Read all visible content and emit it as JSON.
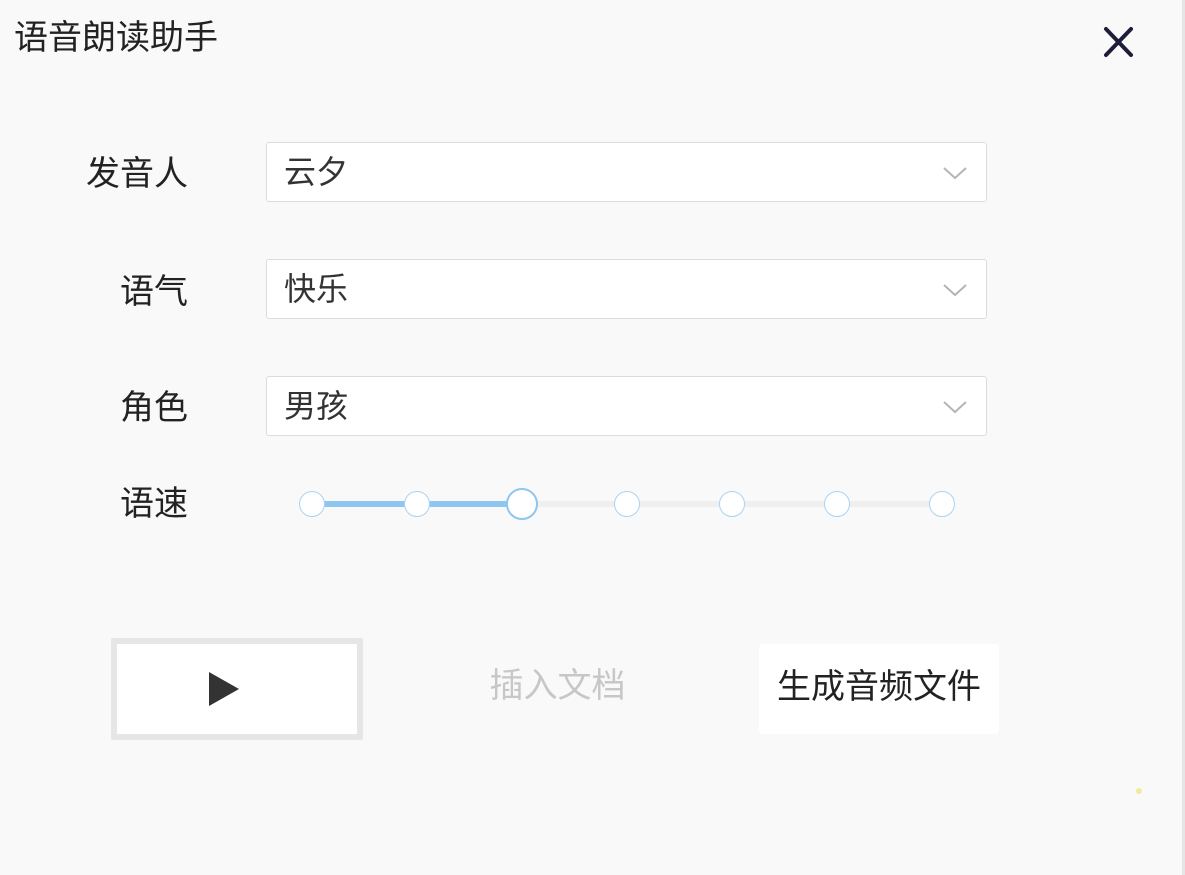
{
  "window": {
    "title": "语音朗读助手"
  },
  "icons": {
    "close": "close-icon",
    "chevron": "chevron-down-icon",
    "play": "play-icon"
  },
  "form": {
    "speaker": {
      "label": "发音人",
      "value": "云夕"
    },
    "tone": {
      "label": "语气",
      "value": "快乐"
    },
    "role": {
      "label": "角色",
      "value": "男孩"
    },
    "speed": {
      "label": "语速",
      "steps": 7,
      "selected_index": 2
    }
  },
  "actions": {
    "insert_label": "插入文档",
    "generate_label": "生成音频文件"
  },
  "colors": {
    "background": "#f9f9f9",
    "accent": "#8fc6f0",
    "disabled_text": "#c7c7c7"
  }
}
